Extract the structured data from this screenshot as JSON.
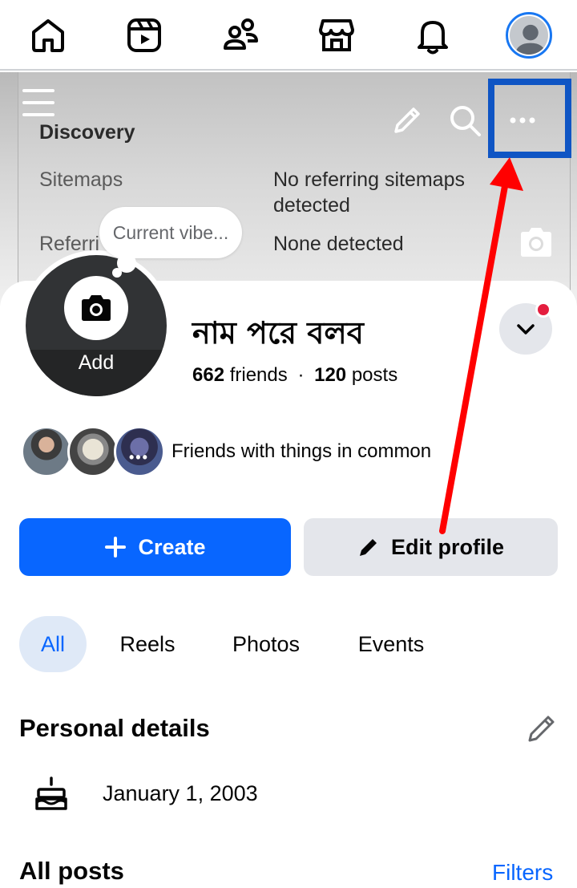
{
  "nav": {
    "items": [
      "home",
      "reels",
      "friends",
      "marketplace",
      "notifications",
      "profile"
    ]
  },
  "cover": {
    "background_text": {
      "heading": "Discovery",
      "row1_label": "Sitemaps",
      "row1_value_line1": "No referring sitemaps",
      "row1_value_line2": "detected",
      "row2_label": "Referri",
      "row2_value": "None detected"
    }
  },
  "profile": {
    "vibe_placeholder": "Current vibe...",
    "avatar_add_label": "Add",
    "name": "নাম পরে বলব",
    "friends_count": "662",
    "friends_label": "friends",
    "separator": "·",
    "posts_count": "120",
    "posts_label": "posts",
    "mutual_friends_text": "Friends with things in common"
  },
  "actions": {
    "create_label": "Create",
    "edit_label": "Edit profile"
  },
  "tabs": [
    {
      "label": "All",
      "active": true
    },
    {
      "label": "Reels",
      "active": false
    },
    {
      "label": "Photos",
      "active": false
    },
    {
      "label": "Events",
      "active": false
    }
  ],
  "personal_details": {
    "title": "Personal details",
    "birthday": "January 1, 2003"
  },
  "posts": {
    "title": "All posts",
    "filters_label": "Filters"
  },
  "colors": {
    "accent": "#0866ff",
    "highlight_box": "#0f55c4",
    "annotation_arrow": "#ff0000",
    "notification_dot": "#e41e3f"
  }
}
